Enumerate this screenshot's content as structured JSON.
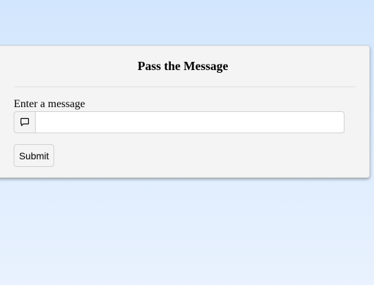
{
  "card": {
    "title": "Pass the Message"
  },
  "form": {
    "label": "Enter a message",
    "input_value": "",
    "input_icon": "speech-bubble-icon",
    "submit_label": "Submit"
  }
}
